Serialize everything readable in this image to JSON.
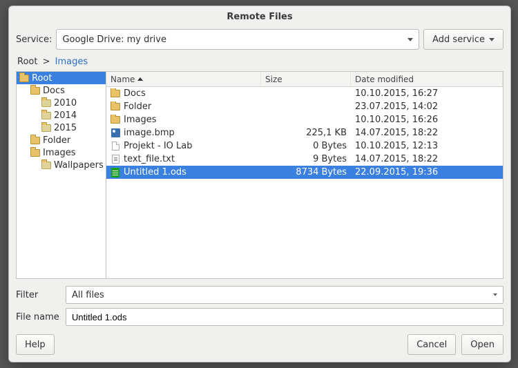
{
  "title": "Remote Files",
  "service": {
    "label": "Service:",
    "selected": "Google Drive: my drive",
    "add_button": "Add service"
  },
  "breadcrumb": {
    "root": "Root",
    "sep": ">",
    "current": "Images"
  },
  "tree": [
    {
      "label": "Root",
      "indent": 0,
      "icon": "folder-open",
      "selected": true
    },
    {
      "label": "Docs",
      "indent": 1,
      "icon": "folder-open"
    },
    {
      "label": "2010",
      "indent": 2,
      "icon": "folder-closed"
    },
    {
      "label": "2014",
      "indent": 2,
      "icon": "folder-closed"
    },
    {
      "label": "2015",
      "indent": 2,
      "icon": "folder-closed"
    },
    {
      "label": "Folder",
      "indent": 1,
      "icon": "folder-open"
    },
    {
      "label": "Images",
      "indent": 1,
      "icon": "folder-open"
    },
    {
      "label": "Wallpapers",
      "indent": 2,
      "icon": "folder-closed"
    }
  ],
  "columns": {
    "name": "Name",
    "size": "Size",
    "date": "Date modified"
  },
  "files": [
    {
      "name": "Docs",
      "size": "",
      "date": "10.10.2015, 16:27",
      "icon": "folder"
    },
    {
      "name": "Folder",
      "size": "",
      "date": "23.07.2015, 14:02",
      "icon": "folder"
    },
    {
      "name": "Images",
      "size": "",
      "date": "10.10.2015, 16:26",
      "icon": "folder"
    },
    {
      "name": "image.bmp",
      "size": "225,1 KB",
      "date": "14.07.2015, 18:22",
      "icon": "bmp"
    },
    {
      "name": "Projekt - IO Lab",
      "size": "0 Bytes",
      "date": "10.10.2015, 12:13",
      "icon": "doc"
    },
    {
      "name": "text_file.txt",
      "size": "9 Bytes",
      "date": "14.07.2015, 18:22",
      "icon": "txt"
    },
    {
      "name": "Untitled 1.ods",
      "size": "8734 Bytes",
      "date": "22.09.2015, 19:36",
      "icon": "ods",
      "selected": true
    }
  ],
  "filter": {
    "label": "Filter",
    "value": "All files"
  },
  "filename": {
    "label": "File name",
    "value": "Untitled 1.ods"
  },
  "buttons": {
    "help": "Help",
    "cancel": "Cancel",
    "open": "Open"
  }
}
